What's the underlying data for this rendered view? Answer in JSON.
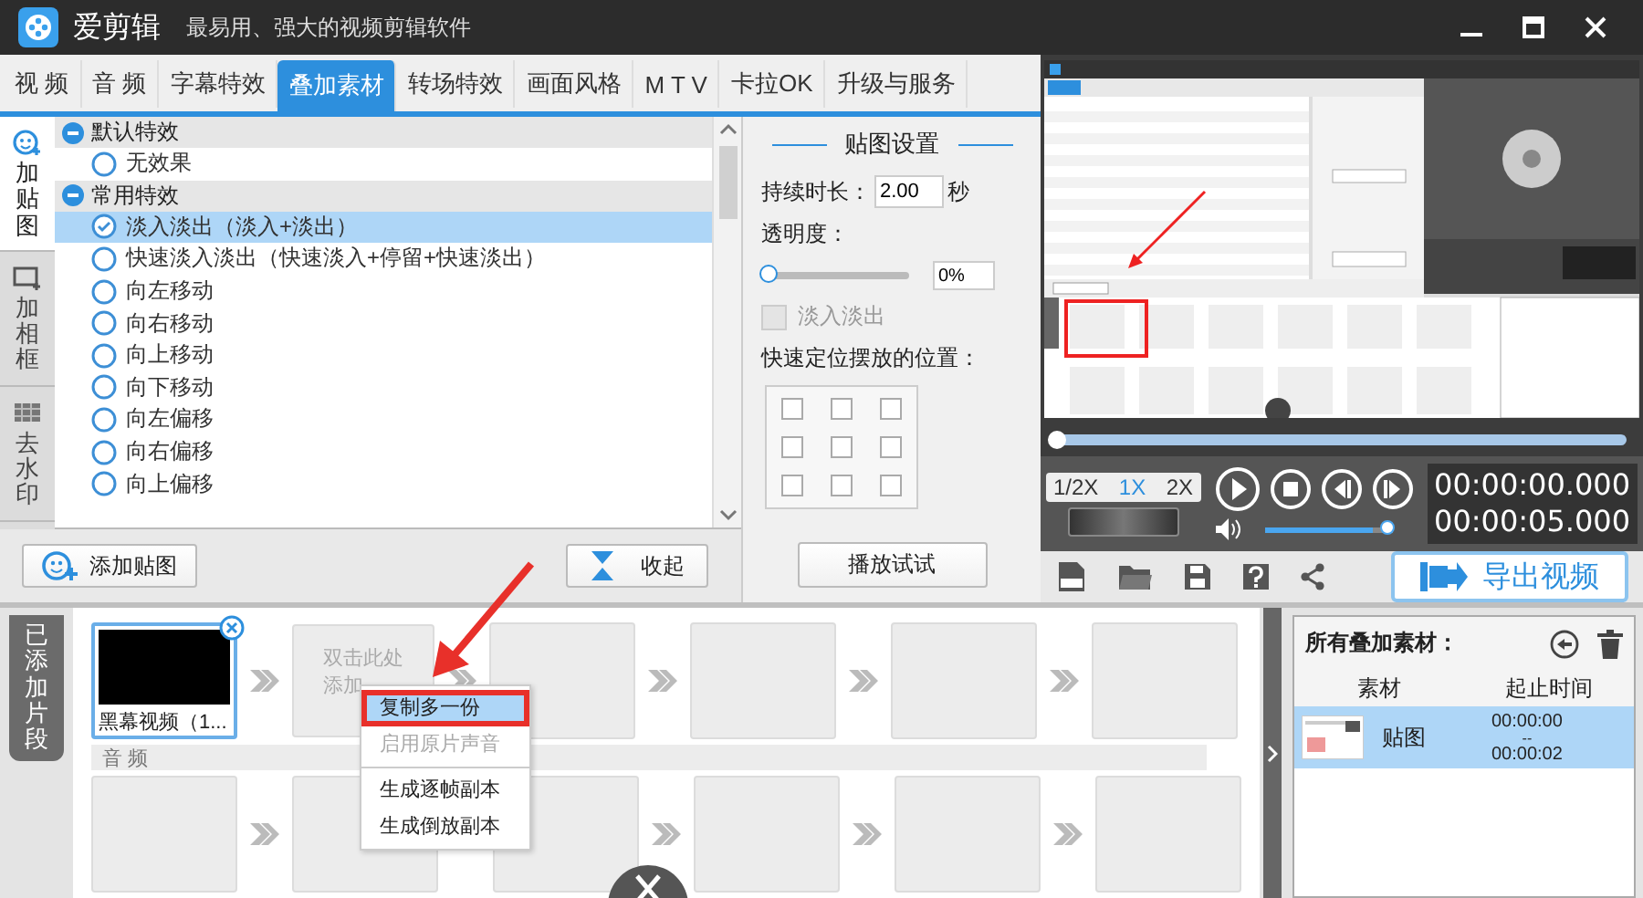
{
  "app": {
    "name": "爱剪辑",
    "tagline": "最易用、强大的视频剪辑软件"
  },
  "tabs": [
    {
      "label": "视 频",
      "selected": false
    },
    {
      "label": "音 频",
      "selected": false
    },
    {
      "label": "字幕特效",
      "selected": false
    },
    {
      "label": "叠加素材",
      "selected": true
    },
    {
      "label": "转场特效",
      "selected": false
    },
    {
      "label": "画面风格",
      "selected": false
    },
    {
      "label": "M T V",
      "selected": false
    },
    {
      "label": "卡拉OK",
      "selected": false
    },
    {
      "label": "升级与服务",
      "selected": false
    }
  ],
  "side_tabs": [
    {
      "kind": "sticker",
      "label": "加贴图",
      "selected": true
    },
    {
      "kind": "frame",
      "label": "加相框",
      "selected": false
    },
    {
      "kind": "watermark",
      "label": "去水印",
      "selected": false
    }
  ],
  "effects": [
    {
      "label": "默认特效",
      "expanded": true,
      "children": [
        {
          "label": "无效果",
          "selected": false
        }
      ]
    },
    {
      "label": "常用特效",
      "expanded": true,
      "children": [
        {
          "label": "淡入淡出（淡入+淡出）",
          "selected": true
        },
        {
          "label": "快速淡入淡出（快速淡入+停留+快速淡出）",
          "selected": false
        },
        {
          "label": "向左移动",
          "selected": false
        },
        {
          "label": "向右移动",
          "selected": false
        },
        {
          "label": "向上移动",
          "selected": false
        },
        {
          "label": "向下移动",
          "selected": false
        },
        {
          "label": "向左偏移",
          "selected": false
        },
        {
          "label": "向右偏移",
          "selected": false
        },
        {
          "label": "向上偏移",
          "selected": false
        }
      ]
    }
  ],
  "list_buttons": {
    "add": "添加贴图",
    "collapse": "收起"
  },
  "settings": {
    "title": "贴图设置",
    "duration_label": "持续时长：",
    "duration": "2.00",
    "duration_unit": "秒",
    "opacity_label": "透明度：",
    "opacity": {
      "level": 0
    },
    "opacity_value": "0%",
    "fade": {
      "label": "淡入淡出",
      "checked": false,
      "disabled": true
    },
    "position_label": "快速定位摆放的位置：",
    "positions": [
      {
        "checked": false
      },
      {
        "checked": false
      },
      {
        "checked": false
      },
      {
        "checked": false
      },
      {
        "checked": false
      },
      {
        "checked": false
      },
      {
        "checked": false
      },
      {
        "checked": false
      },
      {
        "checked": false
      }
    ],
    "play_button": "播放试试"
  },
  "player": {
    "progress": {
      "level": 0
    },
    "speeds": [
      {
        "label": "1/2X",
        "selected": false
      },
      {
        "label": "1X",
        "selected": true
      },
      {
        "label": "2X",
        "selected": false
      }
    ],
    "volume": {
      "level": 0.85
    },
    "current_time": "00:00:00.000",
    "total_time": "00:00:05.000",
    "export_button": "导出视频"
  },
  "timeline": {
    "tab": "已添加片段",
    "clips": [
      {
        "kind": "video",
        "title": "黑幕视频（1..."
      },
      {
        "kind": "hint",
        "lines": [
          "双击此处",
          "添加"
        ]
      },
      {
        "kind": "empty"
      },
      {
        "kind": "empty"
      },
      {
        "kind": "empty"
      },
      {
        "kind": "empty"
      }
    ],
    "audio_label": "音 频",
    "audio_clips": [
      {
        "kind": "empty"
      },
      {
        "kind": "empty"
      },
      {
        "kind": "empty"
      },
      {
        "kind": "empty"
      },
      {
        "kind": "empty"
      },
      {
        "kind": "empty"
      }
    ]
  },
  "context_menu": [
    {
      "label": "复制多一份",
      "selected": true,
      "disabled": false,
      "separator_before": false
    },
    {
      "label": "启用原片声音",
      "selected": false,
      "disabled": true,
      "separator_before": false
    },
    {
      "label": "生成逐帧副本",
      "selected": false,
      "disabled": false,
      "separator_before": true
    },
    {
      "label": "生成倒放副本",
      "selected": false,
      "disabled": false,
      "separator_before": false
    }
  ],
  "overlays": {
    "title": "所有叠加素材：",
    "columns": [
      "素材",
      "起止时间"
    ],
    "rows": [
      {
        "name": "贴图",
        "start": "00:00:00",
        "dash": "--",
        "end": "00:00:02",
        "selected": true
      }
    ]
  }
}
